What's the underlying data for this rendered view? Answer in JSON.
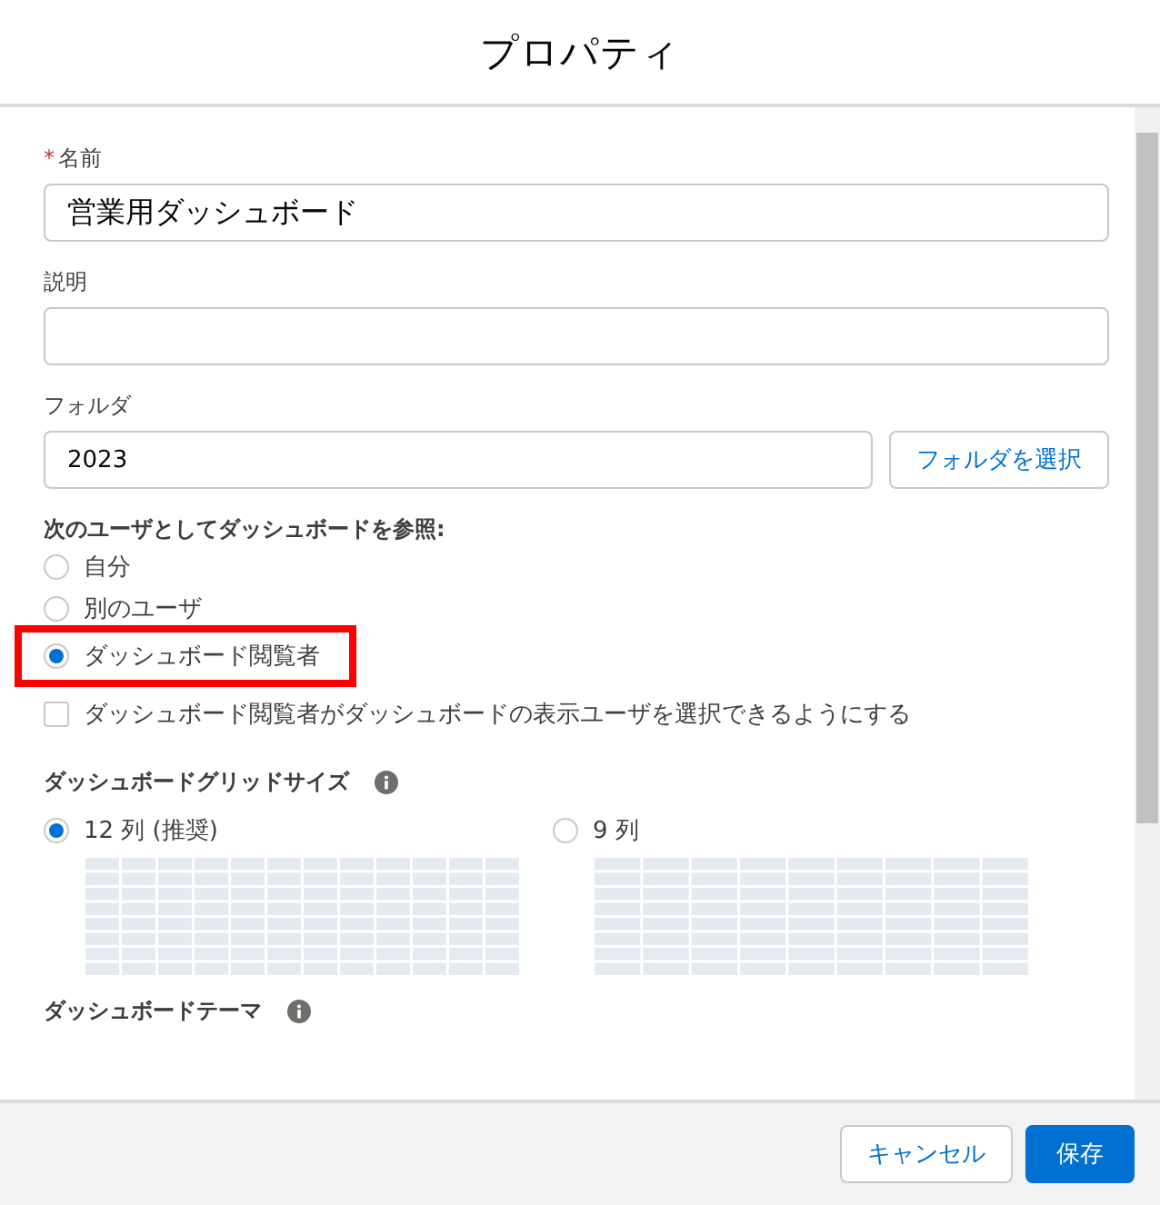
{
  "dialog": {
    "title": "プロパティ"
  },
  "name_field": {
    "label": "名前",
    "required_mark": "*",
    "value": "営業用ダッシュボード"
  },
  "description_field": {
    "label": "説明"
  },
  "folder_field": {
    "label": "フォルダ",
    "value": "2023",
    "button": "フォルダを選択"
  },
  "view_as": {
    "label": "次のユーザとしてダッシュボードを参照:",
    "options": [
      {
        "label": "自分",
        "selected": false,
        "highlighted": false
      },
      {
        "label": "別のユーザ",
        "selected": false,
        "highlighted": false
      },
      {
        "label": "ダッシュボード閲覧者",
        "selected": true,
        "highlighted": true
      }
    ],
    "checkbox": {
      "label": "ダッシュボード閲覧者がダッシュボードの表示ユーザを選択できるようにする",
      "checked": false
    }
  },
  "grid_size": {
    "label": "ダッシュボードグリッドサイズ",
    "options": [
      {
        "label": "12 列 (推奨)",
        "selected": true
      },
      {
        "label": "9 列",
        "selected": false
      }
    ]
  },
  "theme": {
    "label": "ダッシュボードテーマ"
  },
  "footer": {
    "cancel": "キャンセル",
    "save": "保存"
  }
}
